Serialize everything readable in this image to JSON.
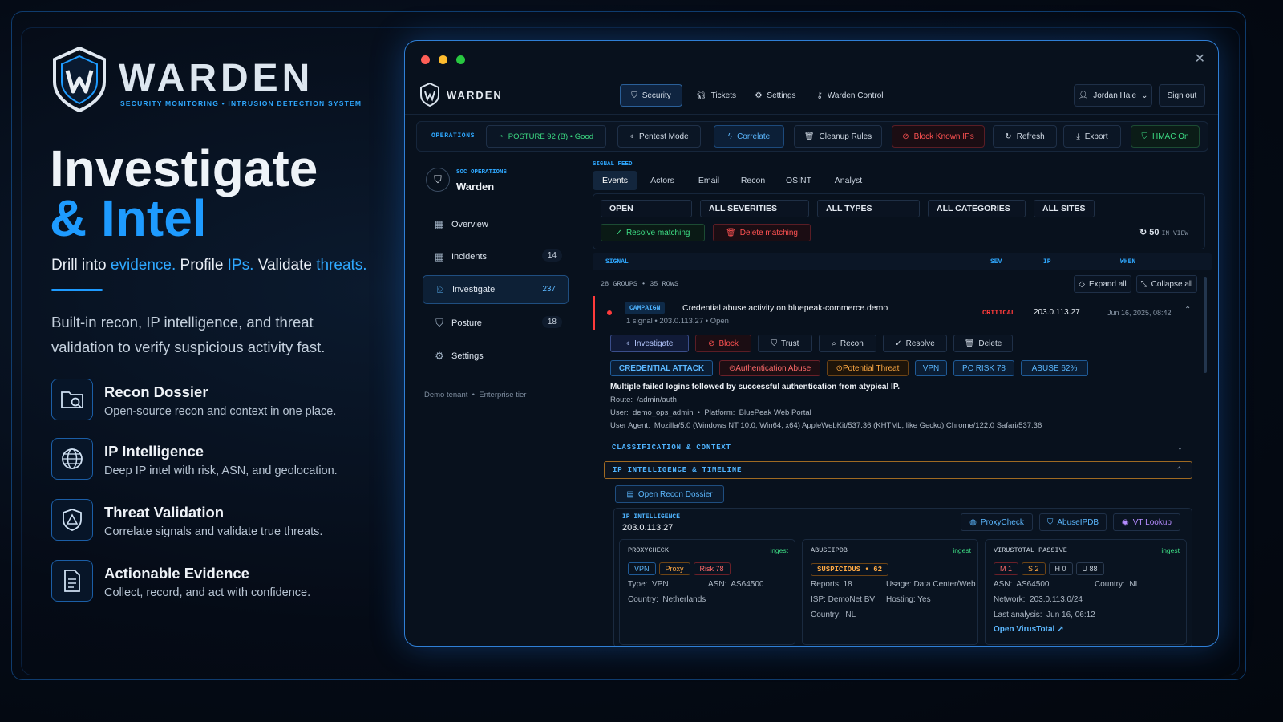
{
  "brand": {
    "name": "WARDEN",
    "tagline": "SECURITY MONITORING • INTRUSION DETECTION SYSTEM"
  },
  "hero": {
    "line1": "Investigate",
    "line2": "& Intel",
    "sub_parts": [
      "Drill into ",
      "evidence.",
      "Profile ",
      "IPs.",
      "Validate ",
      "threats."
    ],
    "description": "Built-in recon, IP intelligence, and threat validation to verify suspicious activity fast."
  },
  "features": [
    {
      "title": "Recon Dossier",
      "desc": "Open-source recon and context in one place.",
      "icon": "folder-search-icon"
    },
    {
      "title": "IP Intelligence",
      "desc": "Deep IP intel with risk, ASN, and geolocation.",
      "icon": "globe-icon"
    },
    {
      "title": "Threat Validation",
      "desc": "Correlate signals and validate true threats.",
      "icon": "shield-alert-icon"
    },
    {
      "title": "Actionable Evidence",
      "desc": "Collect, record, and act with confidence.",
      "icon": "document-icon"
    }
  ],
  "app": {
    "logo": "WARDEN",
    "nav": [
      "Security",
      "Tickets",
      "Settings",
      "Warden Control"
    ],
    "user": "Jordan Hale",
    "signout": "Sign out",
    "ops": {
      "label": "OPERATIONS",
      "posture": "POSTURE 92 (B) • Good",
      "buttons": [
        "Pentest Mode",
        "Correlate",
        "Cleanup Rules",
        "Block Known IPs",
        "Refresh",
        "Export",
        "HMAC On"
      ]
    },
    "sidebar": {
      "kicker": "SOC OPERATIONS",
      "title": "Warden",
      "items": [
        {
          "label": "Overview",
          "count": ""
        },
        {
          "label": "Incidents",
          "count": "14"
        },
        {
          "label": "Investigate",
          "count": "237"
        },
        {
          "label": "Posture",
          "count": "18"
        },
        {
          "label": "Settings",
          "count": ""
        }
      ],
      "footer": "Demo tenant  •  Enterprise tier"
    },
    "feed": {
      "label": "SIGNAL FEED",
      "tabs": [
        "Events",
        "Actors",
        "Email",
        "Recon",
        "OSINT",
        "Analyst"
      ],
      "filters": [
        "OPEN",
        "ALL SEVERITIES",
        "ALL TYPES",
        "ALL CATEGORIES",
        "ALL SITES"
      ],
      "resolve": "Resolve matching",
      "delete": "Delete matching",
      "in_view_count": "50",
      "in_view_label": "IN VIEW",
      "columns": [
        "SIGNAL",
        "SEV",
        "IP",
        "WHEN"
      ],
      "groups": "28 GROUPS • 35 ROWS",
      "expand": "Expand all",
      "collapse": "Collapse all"
    },
    "event": {
      "badge": "CAMPAIGN",
      "title": "Credential abuse activity on bluepeak-commerce.demo",
      "meta": "1 signal • 203.0.113.27 • Open",
      "sev": "CRITICAL",
      "ip": "203.0.113.27",
      "when": "Jun 16, 2025, 08:42",
      "actions": [
        "Investigate",
        "Block",
        "Trust",
        "Recon",
        "Resolve",
        "Delete"
      ],
      "tags": [
        "CREDENTIAL ATTACK",
        "Authentication Abuse",
        "Potential Threat",
        "VPN",
        "PC RISK 78",
        "ABUSE 62%"
      ],
      "summary": "Multiple failed logins followed by successful authentication from atypical IP.",
      "route": "Route:  /admin/auth",
      "user": "User:  demo_ops_admin  •  Platform:  BluePeak Web Portal",
      "agent": "User Agent:  Mozilla/5.0 (Windows NT 10.0; Win64; x64) AppleWebKit/537.36 (KHTML, like Gecko) Chrome/122.0 Safari/537.36",
      "sec1": "CLASSIFICATION & CONTEXT",
      "sec2": "IP INTELLIGENCE & TIMELINE",
      "dossier": "Open Recon Dossier"
    },
    "intel": {
      "label": "IP INTELLIGENCE",
      "ip": "203.0.113.27",
      "links": [
        "ProxyCheck",
        "AbuseIPDB",
        "VT Lookup"
      ],
      "proxy": {
        "title": "PROXYCHECK",
        "ingest": "ingest",
        "chips": [
          "VPN",
          "Proxy",
          "Risk 78"
        ],
        "type": "Type:  VPN",
        "asn": "ASN:  AS64500",
        "country": "Country:  Netherlands"
      },
      "abuse": {
        "title": "ABUSEIPDB",
        "ingest": "ingest",
        "chip": "SUSPICIOUS • 62",
        "reports": "Reports: 18",
        "usage": "Usage: Data Center/Web",
        "isp": "ISP: DemoNet BV",
        "hosting": "Hosting: Yes",
        "country": "Country:  NL"
      },
      "vt": {
        "title": "VIRUSTOTAL PASSIVE",
        "ingest": "ingest",
        "chips": [
          "M 1",
          "S 2",
          "H 0",
          "U 88"
        ],
        "asn": "ASN:  AS64500",
        "country": "Country:  NL",
        "network": "Network:  203.0.113.0/24",
        "last": "Last analysis:  Jun 16, 06:12",
        "open": "Open VirusTotal"
      }
    }
  },
  "colors": {
    "accent": "#1e9bff",
    "critical": "#ff3b3b",
    "success": "#2ecc71",
    "warn": "#ff9a2e"
  }
}
